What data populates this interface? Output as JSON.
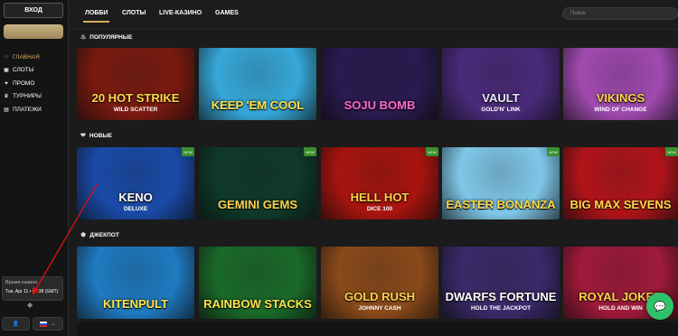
{
  "sidebar": {
    "login_label": "ВХОД",
    "nav": [
      {
        "label": "ГЛАВНАЯ",
        "icon": "home-icon",
        "glyph": "⌂"
      },
      {
        "label": "СЛОТЫ",
        "icon": "slots-icon",
        "glyph": "▣"
      },
      {
        "label": "ПРОМО",
        "icon": "gift-icon",
        "glyph": "✦"
      },
      {
        "label": "ТУРНИРЫ",
        "icon": "trophy-icon",
        "glyph": "♛"
      },
      {
        "label": "ПЛАТЕЖИ",
        "icon": "wallet-icon",
        "glyph": "▤"
      }
    ],
    "time_label": "Время казино",
    "time_value": "Tue, Apr 11 • 07:38 (GMT)",
    "lang_glyph": "⌄"
  },
  "tabs": [
    "ЛОББИ",
    "СЛОТЫ",
    "LIVE-КАЗИНО",
    "GAMES"
  ],
  "search": {
    "placeholder": "Поиск"
  },
  "sections": [
    {
      "title": "ПОПУЛЯРНЫЕ",
      "icon": "fire-icon",
      "glyph": "♨",
      "games": [
        {
          "title": "20 HOT STRIKE",
          "sub": "WILD SCATTER",
          "bg": "#7a1a10",
          "color": "#ffd84a"
        },
        {
          "title": "KEEP 'EM COOL",
          "sub": "",
          "bg": "#36a7d8",
          "color": "#ffe34a"
        },
        {
          "title": "SOJU BOMB",
          "sub": "",
          "bg": "#2a1a4f",
          "color": "#ff6ad0"
        },
        {
          "title": "VAULT",
          "sub": "GOLD'N' LINK",
          "bg": "#4a2a7a",
          "color": "#e8e8ff"
        },
        {
          "title": "VIKINGS",
          "sub": "WIND OF CHANGE",
          "bg": "#a04ab0",
          "color": "#ffd34a"
        }
      ]
    },
    {
      "title": "НОВЫЕ",
      "icon": "heart-icon",
      "glyph": "❤",
      "badge": "NEW",
      "games": [
        {
          "title": "KENO",
          "sub": "DELUXE",
          "bg": "#1a4aa8",
          "color": "#ffffff"
        },
        {
          "title": "GEMINI GEMS",
          "sub": "",
          "bg": "#0f3a2a",
          "color": "#ffd34a"
        },
        {
          "title": "HELL HOT",
          "sub": "DICE 100",
          "bg": "#a8140f",
          "color": "#ffcf4a"
        },
        {
          "title": "EASTER BONANZA",
          "sub": "",
          "bg": "#7fc7e8",
          "color": "#ffd84a"
        },
        {
          "title": "BIG MAX SEVENS",
          "sub": "",
          "bg": "#b0141a",
          "color": "#ffd84a"
        }
      ]
    },
    {
      "title": "ДЖЕКПОТ",
      "icon": "jackpot-icon",
      "glyph": "♚",
      "games": [
        {
          "title": "KITENPULT",
          "sub": "",
          "bg": "#1f7ac0",
          "color": "#ffe34a"
        },
        {
          "title": "RAINBOW STACKS",
          "sub": "",
          "bg": "#1a6a2a",
          "color": "#ffe34a"
        },
        {
          "title": "GOLD RUSH",
          "sub": "JOHNNY CASH",
          "bg": "#8a4a1a",
          "color": "#ffcf4a"
        },
        {
          "title": "DWARFS FORTUNE",
          "sub": "HOLD THE JACKPOT",
          "bg": "#3a2a6a",
          "color": "#ffffff"
        },
        {
          "title": "ROYAL JOKER",
          "sub": "HOLD AND WIN",
          "bg": "#a01a3a",
          "color": "#ffd34a"
        }
      ]
    }
  ],
  "colors": {
    "accent": "#d4af5a",
    "chat": "#2fc26b",
    "annotation_arrow": "#e01010"
  }
}
